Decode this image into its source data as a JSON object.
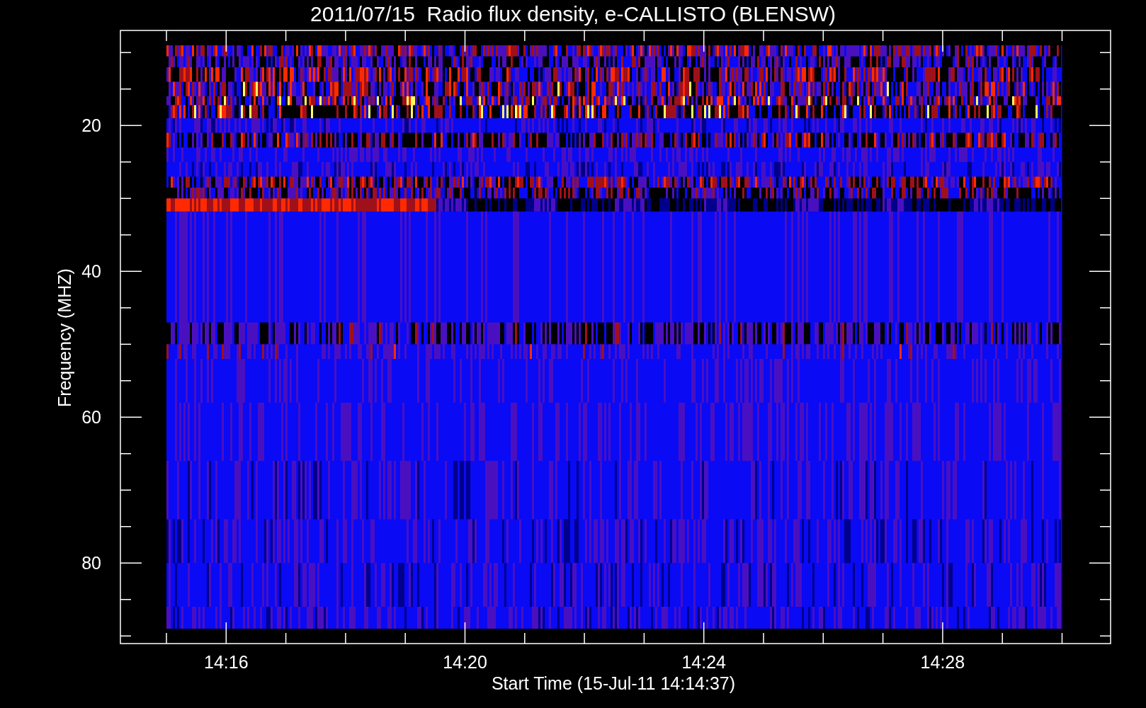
{
  "title": "2011/07/15  Radio flux density, e-CALLISTO (BLENSW)",
  "y_axis": {
    "label": "Frequency (MHZ)",
    "ticks": [
      "20",
      "40",
      "60",
      "80"
    ]
  },
  "x_axis": {
    "label": "Start Time (15-Jul-11 14:14:37)",
    "ticks": [
      "14:16",
      "14:20",
      "14:24",
      "14:28"
    ]
  }
}
